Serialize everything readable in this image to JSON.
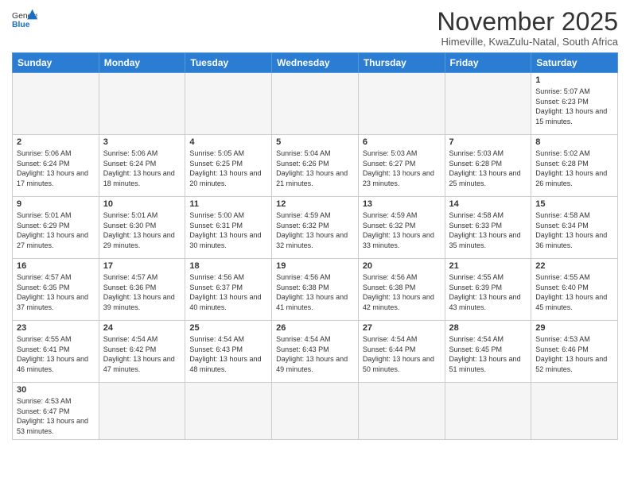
{
  "header": {
    "logo_general": "General",
    "logo_blue": "Blue",
    "month_title": "November 2025",
    "subtitle": "Himeville, KwaZulu-Natal, South Africa"
  },
  "weekdays": [
    "Sunday",
    "Monday",
    "Tuesday",
    "Wednesday",
    "Thursday",
    "Friday",
    "Saturday"
  ],
  "days": [
    {
      "date": "",
      "info": ""
    },
    {
      "date": "",
      "info": ""
    },
    {
      "date": "",
      "info": ""
    },
    {
      "date": "",
      "info": ""
    },
    {
      "date": "",
      "info": ""
    },
    {
      "date": "",
      "info": ""
    },
    {
      "date": "1",
      "info": "Sunrise: 5:07 AM\nSunset: 6:23 PM\nDaylight: 13 hours and 15 minutes."
    },
    {
      "date": "2",
      "info": "Sunrise: 5:06 AM\nSunset: 6:24 PM\nDaylight: 13 hours and 17 minutes."
    },
    {
      "date": "3",
      "info": "Sunrise: 5:06 AM\nSunset: 6:24 PM\nDaylight: 13 hours and 18 minutes."
    },
    {
      "date": "4",
      "info": "Sunrise: 5:05 AM\nSunset: 6:25 PM\nDaylight: 13 hours and 20 minutes."
    },
    {
      "date": "5",
      "info": "Sunrise: 5:04 AM\nSunset: 6:26 PM\nDaylight: 13 hours and 21 minutes."
    },
    {
      "date": "6",
      "info": "Sunrise: 5:03 AM\nSunset: 6:27 PM\nDaylight: 13 hours and 23 minutes."
    },
    {
      "date": "7",
      "info": "Sunrise: 5:03 AM\nSunset: 6:28 PM\nDaylight: 13 hours and 25 minutes."
    },
    {
      "date": "8",
      "info": "Sunrise: 5:02 AM\nSunset: 6:28 PM\nDaylight: 13 hours and 26 minutes."
    },
    {
      "date": "9",
      "info": "Sunrise: 5:01 AM\nSunset: 6:29 PM\nDaylight: 13 hours and 27 minutes."
    },
    {
      "date": "10",
      "info": "Sunrise: 5:01 AM\nSunset: 6:30 PM\nDaylight: 13 hours and 29 minutes."
    },
    {
      "date": "11",
      "info": "Sunrise: 5:00 AM\nSunset: 6:31 PM\nDaylight: 13 hours and 30 minutes."
    },
    {
      "date": "12",
      "info": "Sunrise: 4:59 AM\nSunset: 6:32 PM\nDaylight: 13 hours and 32 minutes."
    },
    {
      "date": "13",
      "info": "Sunrise: 4:59 AM\nSunset: 6:32 PM\nDaylight: 13 hours and 33 minutes."
    },
    {
      "date": "14",
      "info": "Sunrise: 4:58 AM\nSunset: 6:33 PM\nDaylight: 13 hours and 35 minutes."
    },
    {
      "date": "15",
      "info": "Sunrise: 4:58 AM\nSunset: 6:34 PM\nDaylight: 13 hours and 36 minutes."
    },
    {
      "date": "16",
      "info": "Sunrise: 4:57 AM\nSunset: 6:35 PM\nDaylight: 13 hours and 37 minutes."
    },
    {
      "date": "17",
      "info": "Sunrise: 4:57 AM\nSunset: 6:36 PM\nDaylight: 13 hours and 39 minutes."
    },
    {
      "date": "18",
      "info": "Sunrise: 4:56 AM\nSunset: 6:37 PM\nDaylight: 13 hours and 40 minutes."
    },
    {
      "date": "19",
      "info": "Sunrise: 4:56 AM\nSunset: 6:38 PM\nDaylight: 13 hours and 41 minutes."
    },
    {
      "date": "20",
      "info": "Sunrise: 4:56 AM\nSunset: 6:38 PM\nDaylight: 13 hours and 42 minutes."
    },
    {
      "date": "21",
      "info": "Sunrise: 4:55 AM\nSunset: 6:39 PM\nDaylight: 13 hours and 43 minutes."
    },
    {
      "date": "22",
      "info": "Sunrise: 4:55 AM\nSunset: 6:40 PM\nDaylight: 13 hours and 45 minutes."
    },
    {
      "date": "23",
      "info": "Sunrise: 4:55 AM\nSunset: 6:41 PM\nDaylight: 13 hours and 46 minutes."
    },
    {
      "date": "24",
      "info": "Sunrise: 4:54 AM\nSunset: 6:42 PM\nDaylight: 13 hours and 47 minutes."
    },
    {
      "date": "25",
      "info": "Sunrise: 4:54 AM\nSunset: 6:43 PM\nDaylight: 13 hours and 48 minutes."
    },
    {
      "date": "26",
      "info": "Sunrise: 4:54 AM\nSunset: 6:43 PM\nDaylight: 13 hours and 49 minutes."
    },
    {
      "date": "27",
      "info": "Sunrise: 4:54 AM\nSunset: 6:44 PM\nDaylight: 13 hours and 50 minutes."
    },
    {
      "date": "28",
      "info": "Sunrise: 4:54 AM\nSunset: 6:45 PM\nDaylight: 13 hours and 51 minutes."
    },
    {
      "date": "29",
      "info": "Sunrise: 4:53 AM\nSunset: 6:46 PM\nDaylight: 13 hours and 52 minutes."
    },
    {
      "date": "30",
      "info": "Sunrise: 4:53 AM\nSunset: 6:47 PM\nDaylight: 13 hours and 53 minutes."
    }
  ]
}
